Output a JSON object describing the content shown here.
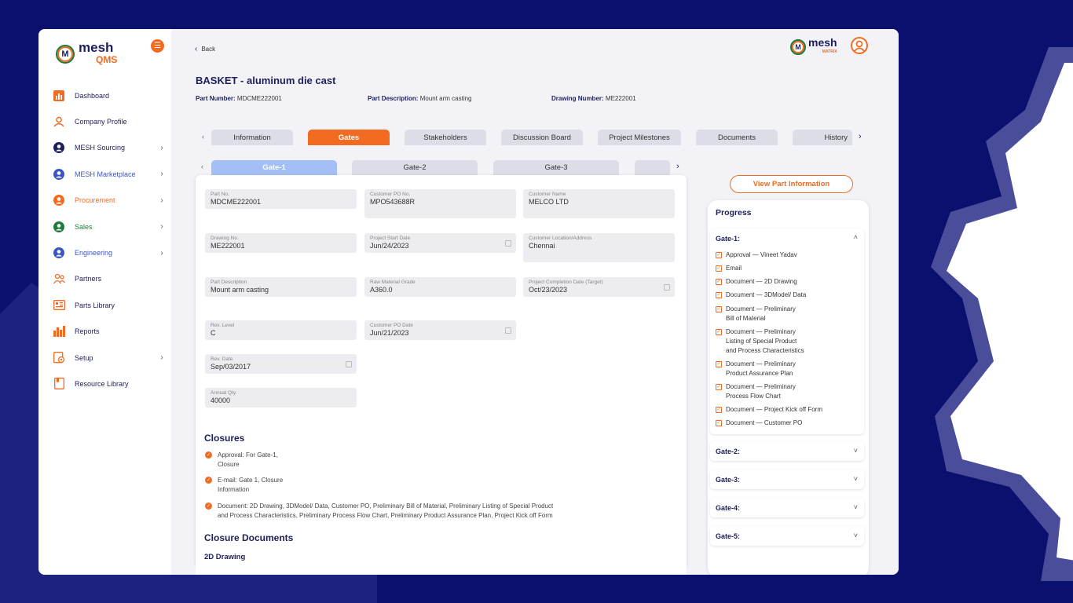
{
  "app": {
    "logo_main": "mesh",
    "logo_sub": "QMS",
    "logo_letter": "M",
    "top_logo": "mesh",
    "top_logo_sub": "MATRIX"
  },
  "sidebar": {
    "items": [
      {
        "label": "Dashboard",
        "icon": "bar-chart-icon",
        "arrow": ""
      },
      {
        "label": "Company Profile",
        "icon": "user-outline-icon",
        "arrow": ""
      },
      {
        "label": "MESH Sourcing",
        "icon": "user-circle-icon",
        "arrow": "›"
      },
      {
        "label": "MESH Marketplace",
        "icon": "user-circle-icon",
        "arrow": "›"
      },
      {
        "label": "Procurement",
        "icon": "user-circle-icon",
        "arrow": "›"
      },
      {
        "label": "Sales",
        "icon": "user-circle-icon",
        "arrow": "›"
      },
      {
        "label": "Engineering",
        "icon": "user-circle-icon",
        "arrow": "›"
      },
      {
        "label": "Partners",
        "icon": "users-icon",
        "arrow": ""
      },
      {
        "label": "Parts Library",
        "icon": "library-icon",
        "arrow": ""
      },
      {
        "label": "Reports",
        "icon": "reports-icon",
        "arrow": ""
      },
      {
        "label": "Setup",
        "icon": "setup-icon",
        "arrow": "›"
      },
      {
        "label": "Resource Library",
        "icon": "book-icon",
        "arrow": ""
      }
    ]
  },
  "header": {
    "back_label": "Back",
    "title": "BASKET - aluminum die cast",
    "part_number_label": "Part Number:",
    "part_number": "MDCME222001",
    "part_description_label": "Part Description:",
    "part_description": "Mount arm casting",
    "drawing_number_label": "Drawing Number:",
    "drawing_number": "ME222001"
  },
  "tabs": [
    "Information",
    "Gates",
    "Stakeholders",
    "Discussion Board",
    "Project Milestones",
    "Documents",
    "History"
  ],
  "gate_tabs": [
    "Gate-1",
    "Gate-2",
    "Gate-3"
  ],
  "fields": {
    "part_no": {
      "label": "Part No.",
      "value": "MDCME222001"
    },
    "customer_po_no": {
      "label": "Customer PO No.",
      "value": "MPO543688R"
    },
    "customer_name": {
      "label": "Customer Name",
      "value": "MELCO LTD"
    },
    "drawing_no": {
      "label": "Drawing No.",
      "value": "ME222001"
    },
    "project_start_date": {
      "label": "Project Start Date",
      "value": "Jun/24/2023"
    },
    "customer_location": {
      "label": "Customer Location/Address",
      "value": "Chennai"
    },
    "part_description": {
      "label": "Part Description",
      "value": "Mount arm casting"
    },
    "raw_material_grade": {
      "label": "Raw Material Grade",
      "value": "A360.0"
    },
    "project_completion_date": {
      "label": "Project Completion Date (Target)",
      "value": "Oct/23/2023"
    },
    "rev_level": {
      "label": "Rev. Level",
      "value": "C"
    },
    "customer_po_date": {
      "label": "Customer PO Date",
      "value": "Jun/21/2023"
    },
    "rev_date": {
      "label": "Rev. Date",
      "value": "Sep/03/2017"
    },
    "annual_qty": {
      "label": "Annual Qty.",
      "value": "40000"
    }
  },
  "closures": {
    "heading": "Closures",
    "items": [
      {
        "line1": "Approval: For Gate-1,",
        "line2": "Closure"
      },
      {
        "line1": "E-mail: Gate 1, Closure",
        "line2": "Information"
      },
      {
        "line1": "Document: 2D Drawing, 3DModel/ Data, Customer PO, Preliminary Bill of Material, Preliminary Listing of Special Product",
        "line2": "and Process Characteristics, Preliminary Process Flow Chart, Preliminary Product Assurance Plan, Project Kick off Form"
      }
    ],
    "documents_heading": "Closure Documents",
    "doc_sub": "2D Drawing"
  },
  "view_button": "View Part Information",
  "progress": {
    "title": "Progress",
    "gate1": "Gate-1:",
    "items": [
      {
        "l1": "Approval — Vineet Yadav",
        "l2": "",
        "l3": ""
      },
      {
        "l1": "Email",
        "l2": "",
        "l3": ""
      },
      {
        "l1": "Document — 2D Drawing",
        "l2": "",
        "l3": ""
      },
      {
        "l1": "Document — 3DModel/ Data",
        "l2": "",
        "l3": ""
      },
      {
        "l1": "Document — Preliminary",
        "l2": "Bill of Material",
        "l3": ""
      },
      {
        "l1": "Document — Preliminary",
        "l2": "Listing of Special Product",
        "l3": "and Process Characteristics"
      },
      {
        "l1": "Document — Preliminary",
        "l2": "Product Assurance Plan",
        "l3": ""
      },
      {
        "l1": "Document — Preliminary",
        "l2": "Process Flow Chart",
        "l3": ""
      },
      {
        "l1": "Document — Project Kick off Form",
        "l2": "",
        "l3": ""
      },
      {
        "l1": "Document — Customer PO",
        "l2": "",
        "l3": ""
      }
    ],
    "closed_gates": [
      "Gate-2:",
      "Gate-3:",
      "Gate-4:",
      "Gate-5:"
    ]
  }
}
